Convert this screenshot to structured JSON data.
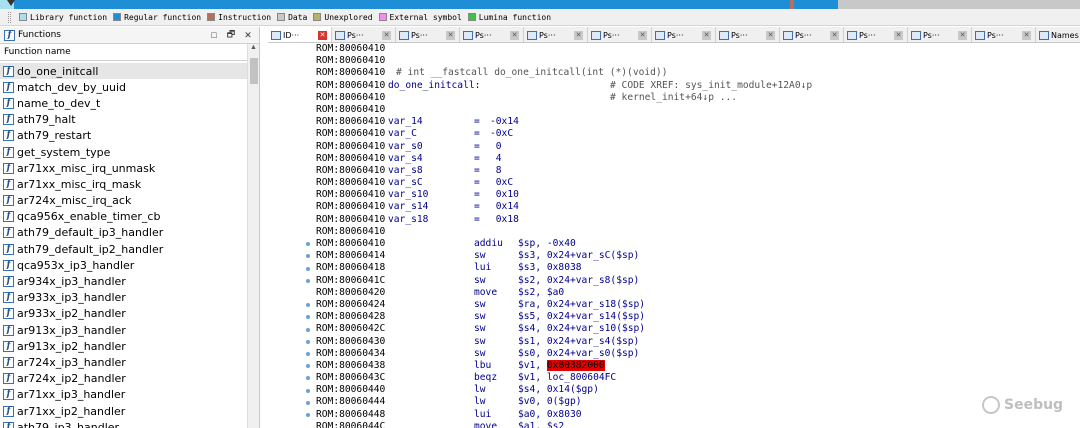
{
  "legend": [
    {
      "label": "Library function",
      "color": "#a8e0f0"
    },
    {
      "label": "Regular function",
      "color": "#1e8fd6"
    },
    {
      "label": "Instruction",
      "color": "#b4705a"
    },
    {
      "label": "Data",
      "color": "#c8c8c8"
    },
    {
      "label": "Unexplored",
      "color": "#b2b46a"
    },
    {
      "label": "External symbol",
      "color": "#f58cf0"
    },
    {
      "label": "Lumina function",
      "color": "#3ec33e"
    }
  ],
  "functions_pane": {
    "title": "Functions",
    "column_header": "Function name",
    "buttons": [
      "□",
      "🗗",
      "✕"
    ],
    "items": [
      "do_one_initcall",
      "match_dev_by_uuid",
      "name_to_dev_t",
      "ath79_halt",
      "ath79_restart",
      "get_system_type",
      "ar71xx_misc_irq_unmask",
      "ar71xx_misc_irq_mask",
      "ar724x_misc_irq_ack",
      "qca956x_enable_timer_cb",
      "ath79_default_ip3_handler",
      "ath79_default_ip2_handler",
      "qca953x_ip3_handler",
      "ar934x_ip3_handler",
      "ar933x_ip3_handler",
      "ar933x_ip2_handler",
      "ar913x_ip3_handler",
      "ar913x_ip2_handler",
      "ar724x_ip3_handler",
      "ar724x_ip2_handler",
      "ar71xx_ip3_handler",
      "ar71xx_ip2_handler",
      "ath79_ip3_handler"
    ],
    "selected_index": 0
  },
  "tabs": [
    {
      "label": "ID···",
      "active": true
    },
    {
      "label": "Ps···"
    },
    {
      "label": "Ps···"
    },
    {
      "label": "Ps···"
    },
    {
      "label": "Ps···"
    },
    {
      "label": "Ps···"
    },
    {
      "label": "Ps···"
    },
    {
      "label": "Ps···"
    },
    {
      "label": "Ps···"
    },
    {
      "label": "Ps···"
    },
    {
      "label": "Ps···"
    },
    {
      "label": "Ps···"
    },
    {
      "label": "Names"
    }
  ],
  "disasm": [
    {
      "addr": "ROM:80060410"
    },
    {
      "addr": "ROM:80060410"
    },
    {
      "addr": "ROM:80060410",
      "proto": "# int __fastcall do_one_initcall(int (*)(void))"
    },
    {
      "addr": "ROM:80060410",
      "label": "do_one_initcall:",
      "xref": "# CODE XREF: sys_init_module+12A0↓p"
    },
    {
      "addr": "ROM:80060410",
      "xref": "# kernel_init+64↓p ..."
    },
    {
      "addr": "ROM:80060410"
    },
    {
      "addr": "ROM:80060410",
      "label": "var_14",
      "eq": "=",
      "val": "-0x14"
    },
    {
      "addr": "ROM:80060410",
      "label": "var_C",
      "eq": "=",
      "val": "-0xC"
    },
    {
      "addr": "ROM:80060410",
      "label": "var_s0",
      "eq": "=",
      "val": " 0"
    },
    {
      "addr": "ROM:80060410",
      "label": "var_s4",
      "eq": "=",
      "val": " 4"
    },
    {
      "addr": "ROM:80060410",
      "label": "var_s8",
      "eq": "=",
      "val": " 8"
    },
    {
      "addr": "ROM:80060410",
      "label": "var_sC",
      "eq": "=",
      "val": " 0xC"
    },
    {
      "addr": "ROM:80060410",
      "label": "var_s10",
      "eq": "=",
      "val": " 0x10"
    },
    {
      "addr": "ROM:80060410",
      "label": "var_s14",
      "eq": "=",
      "val": " 0x14"
    },
    {
      "addr": "ROM:80060410",
      "label": "var_s18",
      "eq": "=",
      "val": " 0x18"
    },
    {
      "addr": "ROM:80060410"
    },
    {
      "addr": "ROM:80060410",
      "mn": "addiu",
      "op": "$sp, -0x40",
      "dot": true
    },
    {
      "addr": "ROM:80060414",
      "mn": "sw",
      "op": "$s3, 0x24+var_sC($sp)",
      "dot": true
    },
    {
      "addr": "ROM:80060418",
      "mn": "lui",
      "op": "$s3, 0x8038",
      "dot": true
    },
    {
      "addr": "ROM:8006041C",
      "mn": "sw",
      "op": "$s2, 0x24+var_s8($sp)",
      "dot": true
    },
    {
      "addr": "ROM:80060420",
      "mn": "move",
      "op": "$s2, $a0"
    },
    {
      "addr": "ROM:80060424",
      "mn": "sw",
      "op": "$ra, 0x24+var_s18($sp)",
      "dot": true
    },
    {
      "addr": "ROM:80060428",
      "mn": "sw",
      "op": "$s5, 0x24+var_s14($sp)",
      "dot": true
    },
    {
      "addr": "ROM:8006042C",
      "mn": "sw",
      "op": "$s4, 0x24+var_s10($sp)",
      "dot": true
    },
    {
      "addr": "ROM:80060430",
      "mn": "sw",
      "op": "$s1, 0x24+var_s4($sp)",
      "dot": true
    },
    {
      "addr": "ROM:80060434",
      "mn": "sw",
      "op": "$s0, 0x24+var_s0($sp)",
      "dot": true
    },
    {
      "addr": "ROM:80060438",
      "mn": "lbu",
      "op": "$v1, ",
      "hl": "0x80382000",
      "dot": true
    },
    {
      "addr": "ROM:8006043C",
      "mn": "beqz",
      "op": "$v1, loc_800604FC",
      "dot": true
    },
    {
      "addr": "ROM:80060440",
      "mn": "lw",
      "op": "$s4, 0x14($gp)",
      "dot": true
    },
    {
      "addr": "ROM:80060444",
      "mn": "lw",
      "op": "$v0, 0($gp)",
      "dot": true
    },
    {
      "addr": "ROM:80060448",
      "mn": "lui",
      "op": "$a0, 0x8030",
      "dot": true
    },
    {
      "addr": "ROM:8006044C",
      "mn": "move",
      "op": "$a1, $s2"
    }
  ],
  "watermark": "Seebug"
}
